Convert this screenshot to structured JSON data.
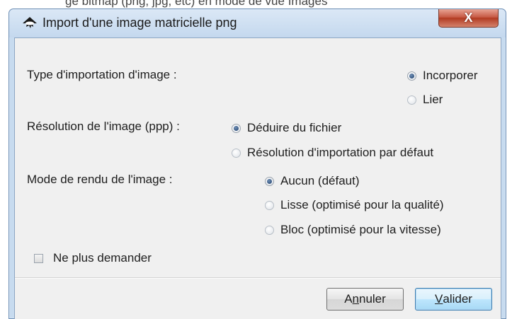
{
  "background": {
    "partial_text": "ge bitmap (png, jpg, etc) en mode de vue Images"
  },
  "window": {
    "title": "Import d'une image matricielle png",
    "close_label": "X"
  },
  "import_type": {
    "label": "Type d'importation d'image :",
    "options": [
      {
        "label": "Incorporer",
        "checked": true
      },
      {
        "label": "Lier",
        "checked": false
      }
    ]
  },
  "resolution": {
    "label": "Résolution de l'image (ppp) :",
    "options": [
      {
        "label": "Déduire du fichier",
        "checked": true
      },
      {
        "label": "Résolution d'importation par défaut",
        "checked": false
      }
    ]
  },
  "render_mode": {
    "label": "Mode de rendu de l'image :",
    "options": [
      {
        "label": "Aucun (défaut)",
        "checked": true
      },
      {
        "label": "Lisse (optimisé pour la qualité)",
        "checked": false
      },
      {
        "label": "Bloc (optimisé pour la vitesse)",
        "checked": false
      }
    ]
  },
  "dont_ask": {
    "label": "Ne plus demander",
    "checked": false
  },
  "buttons": {
    "cancel_pre": "A",
    "cancel_mnemonic": "n",
    "cancel_post": "nuler",
    "ok_pre": "",
    "ok_mnemonic": "V",
    "ok_post": "alider"
  },
  "colors": {
    "title_bar": "#c4d8ee",
    "close_button": "#c75a45",
    "dialog_bg": "#f0f0f0",
    "default_button_border": "#3c7fb1"
  }
}
